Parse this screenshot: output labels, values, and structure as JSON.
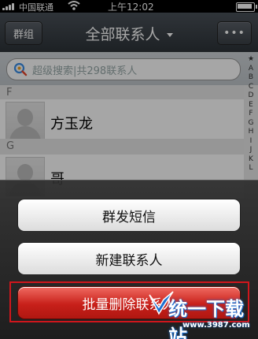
{
  "status_bar": {
    "carrier": "中国联通",
    "time": "上午12:02"
  },
  "nav": {
    "left_button": "群组",
    "title": "全部联系人",
    "right_button": "•••"
  },
  "search": {
    "placeholder": "超级搜索|共298联系人"
  },
  "sections": [
    {
      "letter": "F",
      "contacts": [
        "方玉龙"
      ]
    },
    {
      "letter": "G",
      "contacts": [
        "哥"
      ]
    }
  ],
  "index_letters": [
    "★",
    "A",
    "B",
    "C",
    "D",
    "E",
    "F",
    "G",
    "H",
    "I",
    "J",
    "K",
    "L"
  ],
  "action_sheet": {
    "items": [
      "群发短信",
      "新建联系人",
      "批量删除联系人"
    ]
  },
  "watermark": {
    "text": "统一下载站",
    "url": "www.3987.com"
  },
  "colors": {
    "nav_bar": "#3a4046",
    "danger_button": "#c8201a",
    "highlight_box": "#d0161c"
  }
}
